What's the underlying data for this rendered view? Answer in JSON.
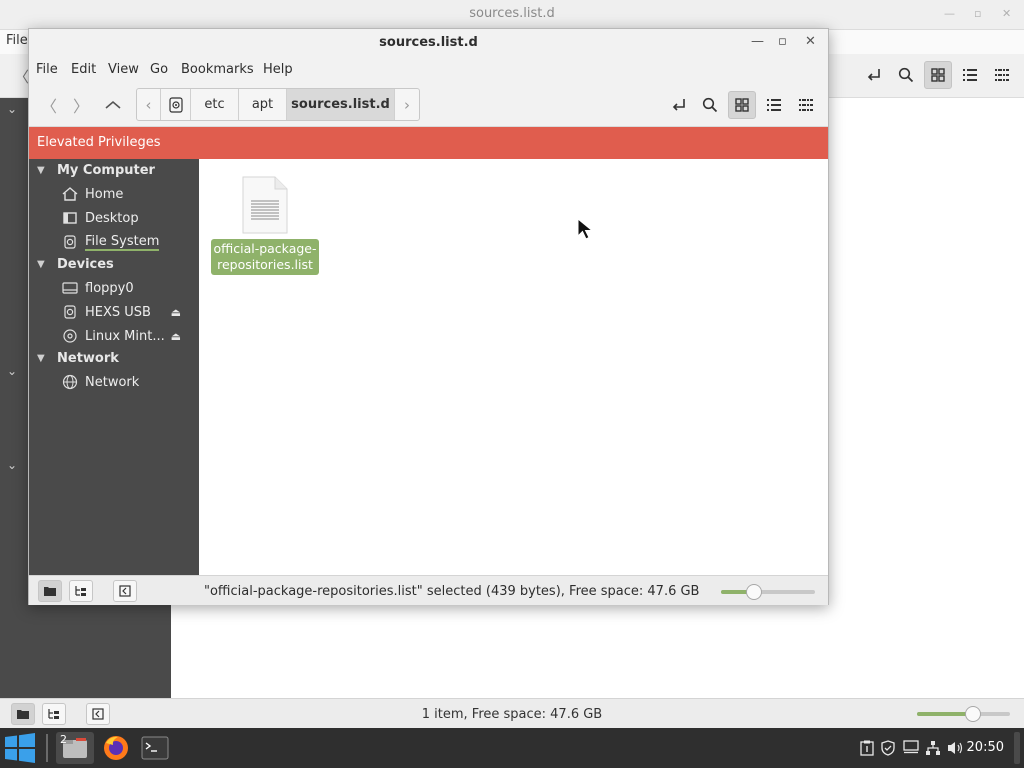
{
  "background_window": {
    "title": "sources.list.d",
    "menu_first": "File",
    "status_text": "1 item, Free space: 47.6 GB",
    "zoom_level": 0.6
  },
  "window": {
    "title": "sources.list.d",
    "controls": [
      "minimize-icon",
      "maximize-icon",
      "close-icon"
    ]
  },
  "menubar": {
    "items": [
      "File",
      "Edit",
      "View",
      "Go",
      "Bookmarks",
      "Help"
    ]
  },
  "breadcrumb": {
    "root_icon": "drive-icon",
    "items": [
      "etc",
      "apt",
      "sources.list.d"
    ],
    "active": "sources.list.d"
  },
  "elevated_banner": {
    "text": "Elevated Privileges",
    "color": "#e05d4e"
  },
  "sidebar": {
    "sections": [
      {
        "title": "My Computer",
        "items": [
          {
            "label": "Home",
            "icon": "home-icon"
          },
          {
            "label": "Desktop",
            "icon": "desktop-icon"
          },
          {
            "label": "File System",
            "icon": "drive-icon",
            "current": true
          }
        ]
      },
      {
        "title": "Devices",
        "items": [
          {
            "label": "floppy0",
            "icon": "floppy-icon"
          },
          {
            "label": "HEXS USB",
            "icon": "usb-drive-icon",
            "eject": true
          },
          {
            "label": "Linux Mint...",
            "icon": "disc-icon",
            "eject": true
          }
        ]
      },
      {
        "title": "Network",
        "items": [
          {
            "label": "Network",
            "icon": "network-globe-icon"
          }
        ]
      }
    ]
  },
  "content": {
    "files": [
      {
        "name": "official-package-repositories.list",
        "label_line1": "official-package-",
        "label_line2": "repositories.list",
        "icon": "text-file-icon",
        "selected": true
      }
    ]
  },
  "statusbar": {
    "text": "\"official-package-repositories.list\" selected (439 bytes), Free space: 47.6 GB",
    "zoom_level": 0.35
  },
  "taskbar": {
    "workspace_badge": "2",
    "clock": "20:50",
    "accent": "#8fb26a"
  }
}
